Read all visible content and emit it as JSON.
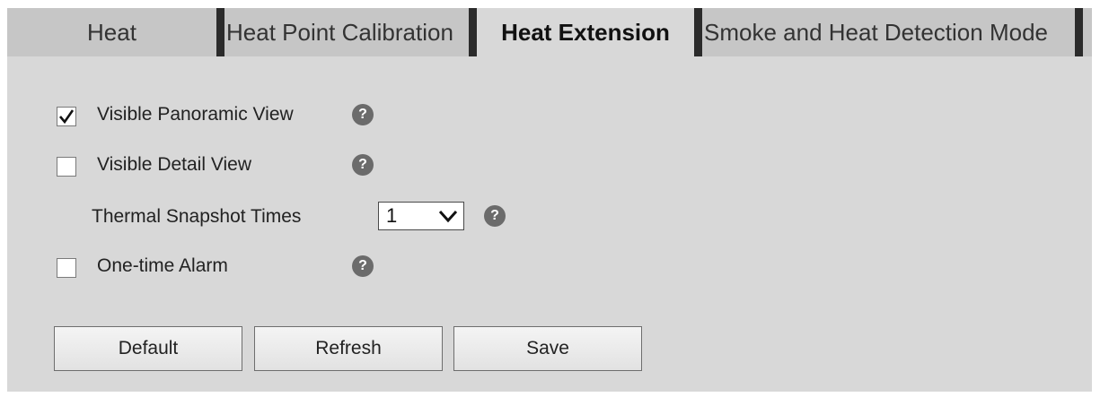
{
  "tabs": [
    {
      "label": "Heat",
      "active": false
    },
    {
      "label": "Heat Point Calibration",
      "active": false
    },
    {
      "label": "Heat Extension",
      "active": true
    },
    {
      "label": "Smoke and Heat Detection Mode",
      "active": false
    }
  ],
  "options": {
    "visible_panoramic": {
      "label": "Visible Panoramic View",
      "checked": true
    },
    "visible_detail": {
      "label": "Visible Detail View",
      "checked": false
    },
    "thermal_snapshot": {
      "label": "Thermal Snapshot Times",
      "value": "1"
    },
    "one_time_alarm": {
      "label": "One-time Alarm",
      "checked": false
    }
  },
  "help_symbol": "?",
  "buttons": {
    "default": "Default",
    "refresh": "Refresh",
    "save": "Save"
  },
  "colors": {
    "panel_bg": "#d8d8d8",
    "tab_bar_bg": "#c6c6c6",
    "tab_separator": "#2b2b2b",
    "help_icon_bg": "#6b6b6b"
  }
}
